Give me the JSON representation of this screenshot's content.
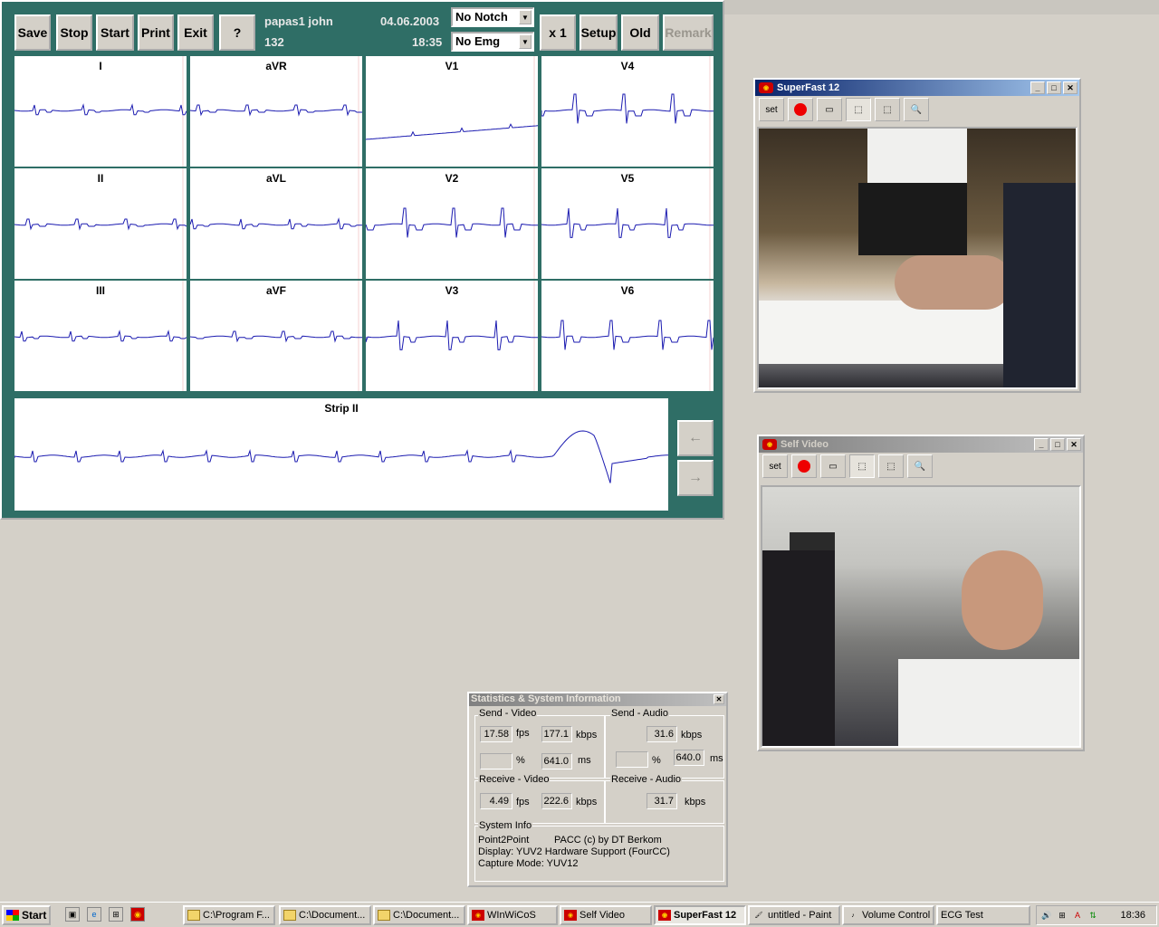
{
  "ecg": {
    "buttons": [
      "Save",
      "Stop",
      "Start",
      "Print",
      "Exit",
      "?",
      "x 1",
      "Setup",
      "Old",
      "Remark"
    ],
    "patient_name": "papas1 john",
    "patient_id": "132",
    "date": "04.06.2003",
    "time": "18:35",
    "notch": "No Notch",
    "emg": "No Emg",
    "leads": [
      "I",
      "aVR",
      "V1",
      "V4",
      "II",
      "aVL",
      "V2",
      "V5",
      "III",
      "aVF",
      "V3",
      "V6"
    ],
    "strip_label": "Strip II",
    "nav_left": "←",
    "nav_right": "→"
  },
  "superfast": {
    "title": "SuperFast 12",
    "toolbar": [
      "set",
      "record",
      "window",
      "zoom-in-frame",
      "zoom-out-frame",
      "1:1"
    ]
  },
  "selfvideo": {
    "title": "Self Video",
    "toolbar": [
      "set",
      "record",
      "window",
      "zoom-in-frame",
      "zoom-out-frame",
      "1:1"
    ]
  },
  "stats": {
    "title": "Statistics & System Information",
    "send_video": {
      "label": "Send - Video",
      "fps": "17.58",
      "fps_unit": "fps",
      "kbps": "177.1",
      "kbps_unit": "kbps",
      "pct": "",
      "pct_unit": "%",
      "ms": "641.0",
      "ms_unit": "ms"
    },
    "send_audio": {
      "label": "Send - Audio",
      "kbps": "31.6",
      "kbps_unit": "kbps",
      "pct": "",
      "pct_unit": "%",
      "ms": "640.0",
      "ms_unit": "ms"
    },
    "receive_video": {
      "label": "Receive - Video",
      "fps": "4.49",
      "fps_unit": "fps",
      "kbps": "222.6",
      "kbps_unit": "kbps"
    },
    "receive_audio": {
      "label": "Receive - Audio",
      "kbps": "31.7",
      "kbps_unit": "kbps"
    },
    "system_info": {
      "label": "System Info",
      "mode": "Point2Point",
      "credit": "PACC (c) by DT Berkom",
      "display": "Display: YUV2 Hardware Support (FourCC)",
      "capture": "Capture Mode: YUV12"
    }
  },
  "taskbar": {
    "start": "Start",
    "tasks": [
      {
        "label": "C:\\Program F...",
        "icon": "folder-icon"
      },
      {
        "label": "C:\\Document...",
        "icon": "folder-icon"
      },
      {
        "label": "C:\\Document...",
        "icon": "folder-icon"
      },
      {
        "label": "WInWiCoS",
        "icon": "app-icon"
      },
      {
        "label": "Self Video",
        "icon": "app-icon"
      },
      {
        "label": "SuperFast 12",
        "icon": "app-icon",
        "active": true
      },
      {
        "label": "untitled - Paint",
        "icon": "paint-icon"
      },
      {
        "label": "Volume Control",
        "icon": "volume-icon"
      },
      {
        "label": "ECG Test",
        "icon": ""
      }
    ],
    "clock": "18:36"
  },
  "colors": {
    "ecg_bg": "#2f6e66",
    "trace": "#1a1ab0",
    "title_active": "#0a246a"
  }
}
